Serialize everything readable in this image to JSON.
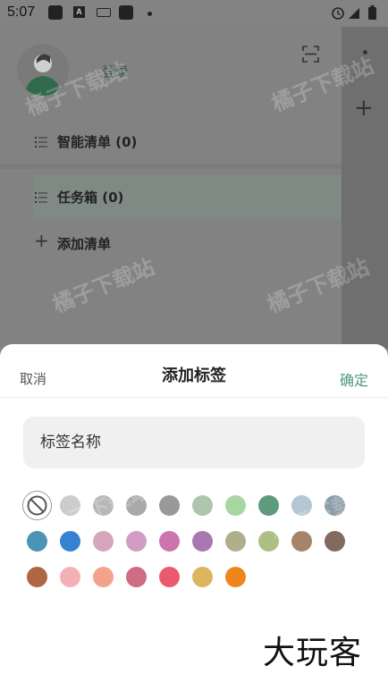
{
  "status_bar": {
    "time": "5:07",
    "app_icon_letter": "A"
  },
  "background": {
    "login_label": "登录",
    "lists": [
      {
        "label": "智能清单 (0)"
      },
      {
        "label": "任务箱 (0)"
      }
    ],
    "add_list_label": "添加清单",
    "add_list_plus": "+",
    "right_plus": "+"
  },
  "watermark_text": "橘子下载站",
  "sheet": {
    "title": "添加标签",
    "cancel_label": "取消",
    "confirm_label": "确定",
    "name_placeholder": "标签名称",
    "colors": [
      "none",
      "#cccccc",
      "#b8b8b8",
      "#a9a9a9",
      "#999999",
      "#adc6ad",
      "#a6d6a2",
      "#5e9a7d",
      "#b3c7d4",
      "#8d9ea8",
      "#4b94b5",
      "#3581d2",
      "#d5a7bc",
      "#d19dc5",
      "#cc74ad",
      "#a977b2",
      "#b0ae8b",
      "#aebf86",
      "#a6846a",
      "#826b5e",
      "#b06645",
      "#f4b1b5",
      "#f4a28d",
      "#cd6c82",
      "#ea5a6f",
      "#ddb55e",
      "#ef861c"
    ]
  },
  "brand_logo": "大玩客"
}
